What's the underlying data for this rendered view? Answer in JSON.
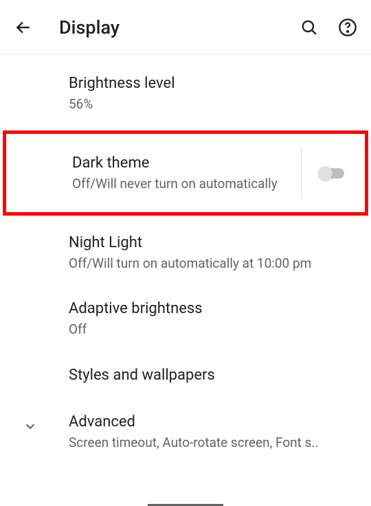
{
  "header": {
    "title": "Display"
  },
  "settings": {
    "brightness": {
      "title": "Brightness level",
      "value": "56%"
    },
    "darkTheme": {
      "title": "Dark theme",
      "subtitle": "Off/Will never turn on automatically",
      "enabled": false
    },
    "nightLight": {
      "title": "Night Light",
      "subtitle": "Off/Will turn on automatically at 10:00 pm"
    },
    "adaptiveBrightness": {
      "title": "Adaptive brightness",
      "subtitle": "Off"
    },
    "stylesWallpapers": {
      "title": "Styles and wallpapers"
    },
    "advanced": {
      "title": "Advanced",
      "subtitle": "Screen timeout, Auto-rotate screen, Font s.."
    }
  }
}
